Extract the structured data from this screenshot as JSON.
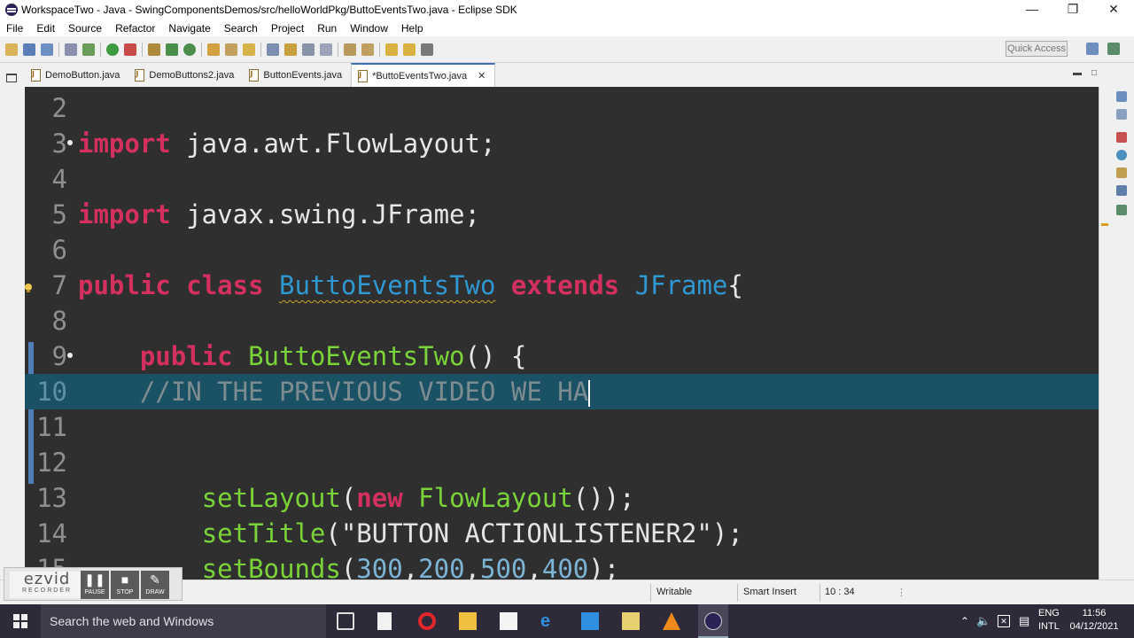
{
  "window": {
    "title": "WorkspaceTwo - Java - SwingComponentsDemos/src/helloWorldPkg/ButtoEventsTwo.java - Eclipse SDK"
  },
  "menu": [
    "File",
    "Edit",
    "Source",
    "Refactor",
    "Navigate",
    "Search",
    "Project",
    "Run",
    "Window",
    "Help"
  ],
  "toolbar": {
    "quick_access": "Quick Access"
  },
  "tabs": [
    {
      "label": "DemoButton.java",
      "active": false
    },
    {
      "label": "DemoButtons2.java",
      "active": false
    },
    {
      "label": "ButtonEvents.java",
      "active": false
    },
    {
      "label": "*ButtoEventsTwo.java",
      "active": true
    }
  ],
  "editor": {
    "lines": [
      {
        "n": "2"
      },
      {
        "n": "3",
        "tokens": [
          [
            "kw",
            "import"
          ],
          [
            "txt",
            " java.awt.FlowLayout;"
          ]
        ]
      },
      {
        "n": "4"
      },
      {
        "n": "5",
        "tokens": [
          [
            "kw",
            "import"
          ],
          [
            "txt",
            " javax.swing.JFrame;"
          ]
        ]
      },
      {
        "n": "6"
      },
      {
        "n": "7",
        "tokens": [
          [
            "kw",
            "public"
          ],
          [
            "txt",
            " "
          ],
          [
            "kw",
            "class"
          ],
          [
            "txt",
            " "
          ],
          [
            "cls-u",
            "ButtoEventsTwo"
          ],
          [
            "txt",
            " "
          ],
          [
            "kw",
            "extends"
          ],
          [
            "txt",
            " "
          ],
          [
            "cls",
            "JFrame"
          ],
          [
            "txt",
            "{"
          ]
        ]
      },
      {
        "n": "8"
      },
      {
        "n": "9",
        "tokens": [
          [
            "txt",
            "    "
          ],
          [
            "kw",
            "public"
          ],
          [
            "txt",
            " "
          ],
          [
            "meth",
            "ButtoEventsTwo"
          ],
          [
            "txt",
            "() {"
          ]
        ]
      },
      {
        "n": "10",
        "tokens": [
          [
            "cmt",
            "    //IN THE PREVIOUS VIDEO WE HA"
          ]
        ]
      },
      {
        "n": "11"
      },
      {
        "n": "12"
      },
      {
        "n": "13",
        "tokens": [
          [
            "txt",
            "        "
          ],
          [
            "meth",
            "setLayout"
          ],
          [
            "txt",
            "("
          ],
          [
            "kw",
            "new"
          ],
          [
            "txt",
            " "
          ],
          [
            "meth",
            "FlowLayout"
          ],
          [
            "txt",
            "());"
          ]
        ]
      },
      {
        "n": "14",
        "tokens": [
          [
            "txt",
            "        "
          ],
          [
            "meth",
            "setTitle"
          ],
          [
            "txt",
            "("
          ],
          [
            "str",
            "\"BUTTON ACTIONLISTENER2\""
          ],
          [
            "txt",
            ");"
          ]
        ]
      },
      {
        "n": "15",
        "tokens": [
          [
            "txt",
            "        "
          ],
          [
            "meth",
            "setBounds"
          ],
          [
            "txt",
            "("
          ],
          [
            "num",
            "300"
          ],
          [
            "txt",
            ","
          ],
          [
            "num",
            "200"
          ],
          [
            "txt",
            ","
          ],
          [
            "num",
            "500"
          ],
          [
            "txt",
            ","
          ],
          [
            "num",
            "400"
          ],
          [
            "txt",
            ");"
          ]
        ]
      }
    ]
  },
  "status": {
    "writable": "Writable",
    "insert_mode": "Smart Insert",
    "position": "10 : 34"
  },
  "recorder": {
    "logo": "ezvid",
    "logo_sub": "RECORDER",
    "buttons": [
      "PAUSE",
      "STOP",
      "DRAW"
    ]
  },
  "taskbar": {
    "search_placeholder": "Search the web and Windows",
    "lang_top": "ENG",
    "lang_bottom": "INTL",
    "time": "11:56",
    "date": "04/12/2021"
  },
  "colors": {
    "keyword": "#d3305f",
    "class": "#2f98d1",
    "method": "#7ad339",
    "comment": "#7c8c90",
    "current_line": "#1b5164",
    "editor_bg": "#2f2f2f"
  }
}
